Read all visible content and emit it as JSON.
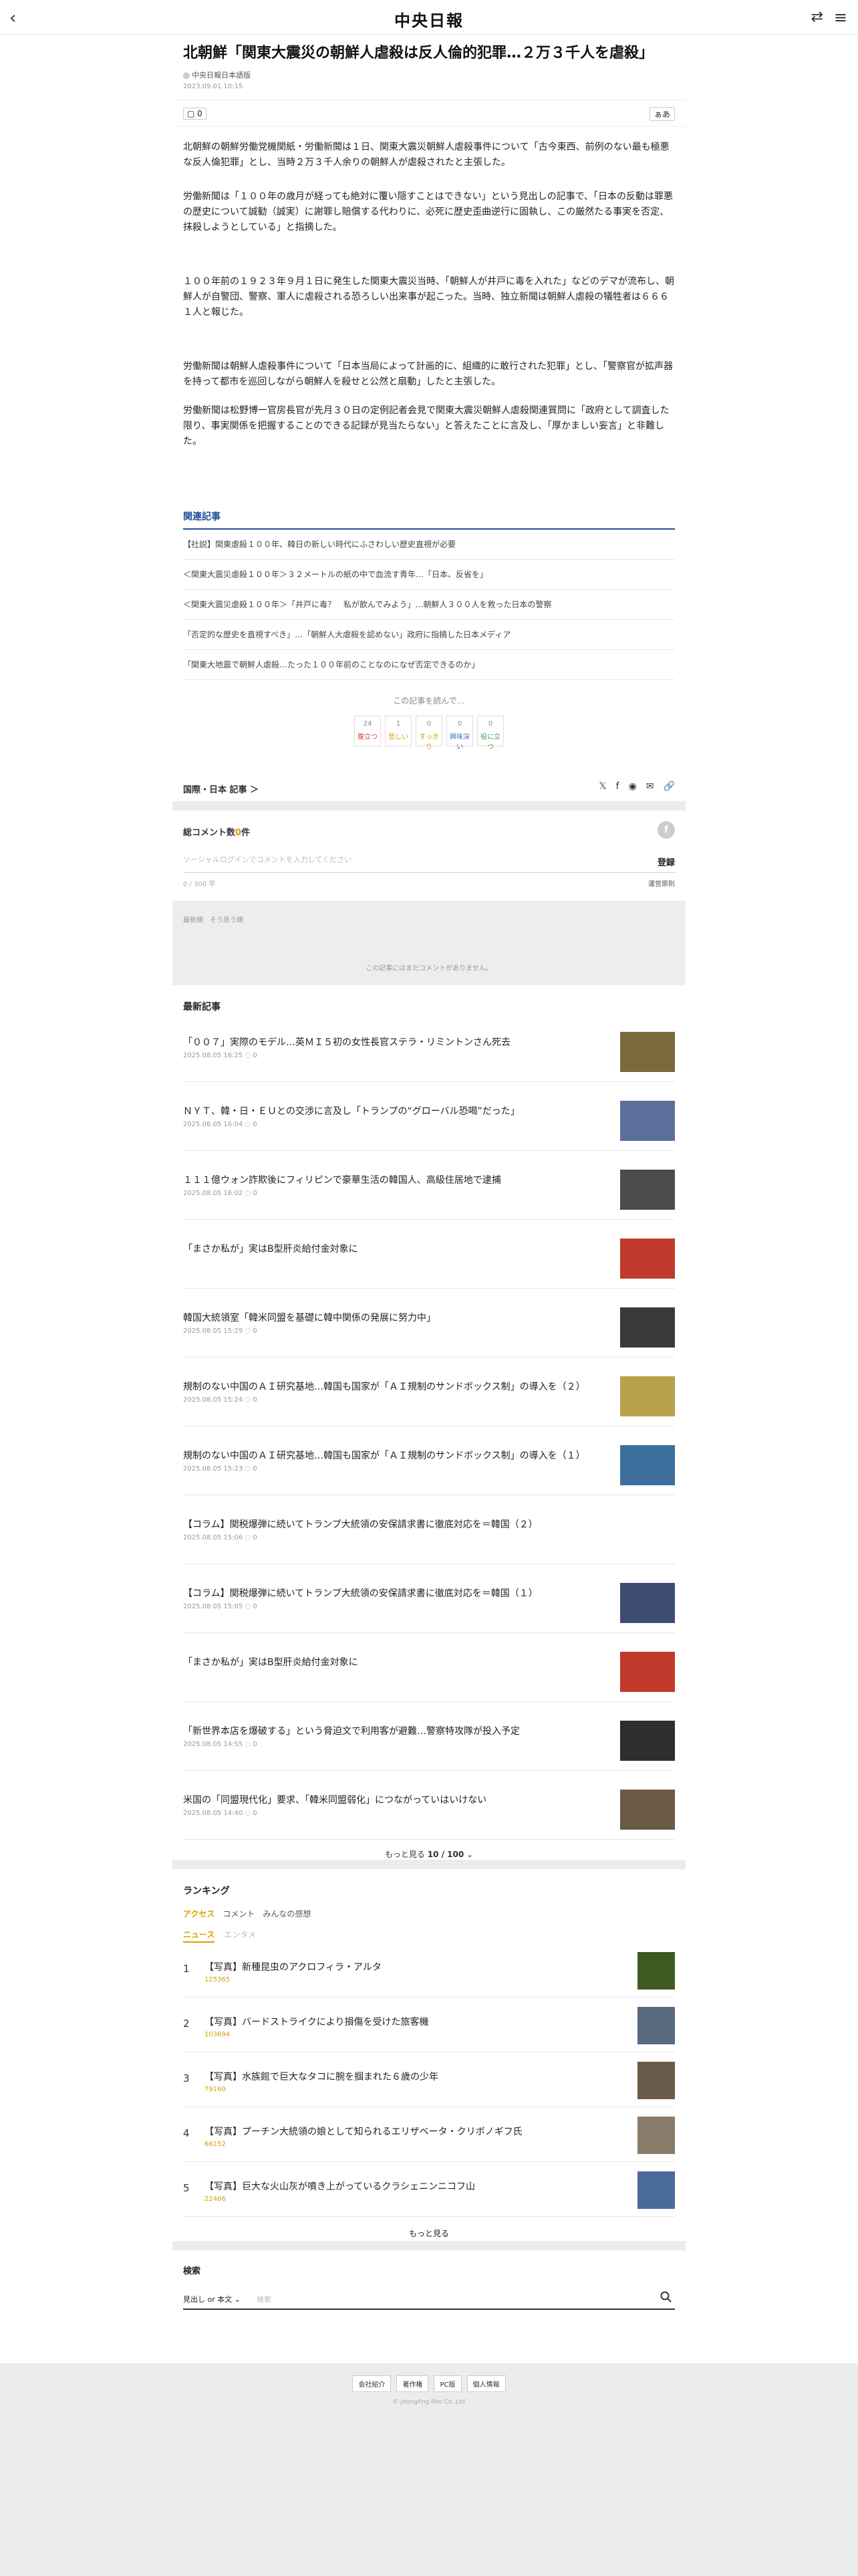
{
  "header": {
    "logo": "中央日報"
  },
  "article": {
    "title": "北朝鮮「関東大震災の朝鮮人虐殺は反人倫的犯罪…２万３千人を虐殺」",
    "source": "中央日報日本語版",
    "date": "2023.09.01 10:15",
    "comment_count": "0",
    "font_label": "あ",
    "paragraphs": [
      "北朝鮮の朝鮮労働党機関紙・労働新聞は１日、関東大震災朝鮮人虐殺事件について「古今東西、前例のない最も極悪な反人倫犯罪」とし、当時２万３千人余りの朝鮮人が虐殺されたと主張した。",
      "労働新聞は「１００年の歳月が経っても絶対に覆い隠すことはできない」という見出しの記事で、「日本の反動は罪悪の歴史について誠勧（誠実）に謝罪し賠償する代わりに、必死に歴史歪曲逆行に固執し、この厳然たる事実を否定、抹殺しようとしている」と指摘した。",
      "１００年前の１９２３年９月１日に発生した関東大震災当時、「朝鮮人が井戸に毒を入れた」などのデマが流布し、朝鮮人が自警団、警察、軍人に虐殺される恐ろしい出来事が起こった。当時、独立新聞は朝鮮人虐殺の犠牲者は６６６１人と報じた。",
      "労働新聞は朝鮮人虐殺事件について「日本当局によって計画的に、組織的に敢行された犯罪」とし、「警察官が拡声器を持って都市を巡回しながら朝鮮人を殺せと公然と扇動」したと主張した。",
      "労働新聞は松野博一官房長官が先月３０日の定例記者会見で関東大震災朝鮮人虐殺関連質問に「政府として調査した限り、事実関係を把握することのできる記録が見当たらない」と答えたことに言及し、「厚かましい妄言」と非難した。"
    ]
  },
  "related": {
    "heading": "関連記事",
    "items": [
      "【社説】関東虐殺１００年、韓日の新しい時代にふさわしい歴史直視が必要",
      "＜関東大震災虐殺１００年＞３２メートルの紙の中で血流す青年…「日本、反省を」",
      "＜関東大震災虐殺１００年＞「井戸に毒？　私が飲んでみよう」…朝鮮人３００人を救った日本の警察",
      "「否定的な歴史を直視すべき」…「朝鮮人大虐殺を認めない」政府に指摘した日本メディア",
      "「関東大地震で朝鮮人虐殺…たった１００年前のことなのになぜ否定できるのか」"
    ],
    "after_reading": "この記事を読んで…",
    "reactions": [
      {
        "count": "24",
        "label": "腹立つ",
        "color": "#d04a3a"
      },
      {
        "count": "1",
        "label": "悲しい",
        "color": "#d4a100"
      },
      {
        "count": "0",
        "label": "すっきり",
        "color": "#d4a100"
      },
      {
        "count": "0",
        "label": "興味深い",
        "color": "#3b78c4"
      },
      {
        "count": "0",
        "label": "役に立つ",
        "color": "#3aa05a"
      }
    ]
  },
  "category": {
    "label": "国際・日本 記事 ＞",
    "share_icons": [
      "𝕏",
      "f",
      "◉",
      "✉",
      "🔗"
    ]
  },
  "comments": {
    "count_label_prefix": "総コメント数",
    "count_value": "0",
    "count_label_suffix": "件",
    "input_placeholder": "ソーシャルログインでコメントを入力してください",
    "register": "登録",
    "limit": "0 / 300 字",
    "rules": "運営原則",
    "sort": "最新順　そう思う順",
    "none": "この記事にはまだコメントがありません。"
  },
  "latest": {
    "heading": "最新記事",
    "items": [
      {
        "title": "「００７」実際のモデル…英ＭＩ５初の女性長官ステラ・リミントンさん死去",
        "meta": "2025.08.05 16:25 ◌ 0"
      },
      {
        "title": "ＮＹＴ、韓・日・ＥＵとの交渉に言及し「トランプの“グローバル恐喝”だった」",
        "meta": "2025.08.05 16:04 ◌ 0"
      },
      {
        "title": "１１１億ウォン詐欺後にフィリピンで豪華生活の韓国人、高級住居地で逮捕",
        "meta": "2025.08.05 16:02 ◌ 0"
      },
      {
        "title": "「まさか私が」実はB型肝炎給付金対象に",
        "meta": ""
      },
      {
        "title": "韓国大統領室「韓米同盟を基礎に韓中関係の発展に努力中」",
        "meta": "2025.08.05 15:29 ◌ 0"
      },
      {
        "title": "規制のない中国のＡＩ研究基地…韓国も国家が「ＡＩ規制のサンドボックス制」の導入を（２）",
        "meta": "2025.08.05 15:24 ◌ 0"
      },
      {
        "title": "規制のない中国のＡＩ研究基地…韓国も国家が「ＡＩ規制のサンドボックス制」の導入を（１）",
        "meta": "2025.08.05 15:23 ◌ 0"
      },
      {
        "title": "【コラム】関税爆弾に続いてトランプ大統領の安保請求書に徹底対応を＝韓国（２）",
        "meta": "2025.08.05 15:06 ◌ 0"
      },
      {
        "title": "【コラム】関税爆弾に続いてトランプ大統領の安保請求書に徹底対応を＝韓国（１）",
        "meta": "2025.08.05 15:05 ◌ 0"
      },
      {
        "title": "「まさか私が」実はB型肝炎給付金対象に",
        "meta": ""
      },
      {
        "title": "「新世界本店を爆破する」という脅迫文で利用客が避難…警察特攻隊が投入予定",
        "meta": "2025.08.05 14:55 ◌ 0"
      },
      {
        "title": "米国の「同盟現代化」要求、「韓米同盟弱化」につながっていはいけない",
        "meta": "2025.08.05 14:40 ◌ 0"
      }
    ],
    "more_prefix": "もっと見る ",
    "more_count": "10 / 100"
  },
  "ranking": {
    "heading": "ランキング",
    "tabs": [
      "アクセス",
      "コメント",
      "みんなの感想"
    ],
    "subtabs": [
      "ニュース",
      "エンタメ"
    ],
    "items": [
      {
        "no": "1",
        "title": "【写真】新種昆虫のアクロフィラ・アルタ",
        "views": "125365"
      },
      {
        "no": "2",
        "title": "【写真】バードストライクにより損傷を受けた旅客機",
        "views": "103694"
      },
      {
        "no": "3",
        "title": "【写真】水族館で巨大なタコに腕を掴まれた６歳の少年",
        "views": "79160"
      },
      {
        "no": "4",
        "title": "【写真】プーチン大統領の娘として知られるエリザベータ・クリボノギフ氏",
        "views": "66152"
      },
      {
        "no": "5",
        "title": "【写真】巨大な火山灰が噴き上がっているクラシェニンニコフ山",
        "views": "22466"
      }
    ],
    "more": "もっと見る"
  },
  "search": {
    "heading": "検索",
    "select": "見出し or 本文 ⌄",
    "placeholder": "検索"
  },
  "footer": {
    "links": [
      "会社紹介",
      "著作権",
      "PC版",
      "個人情報"
    ],
    "copyright": "© JoongAng Ilbo Co.,Ltd"
  }
}
